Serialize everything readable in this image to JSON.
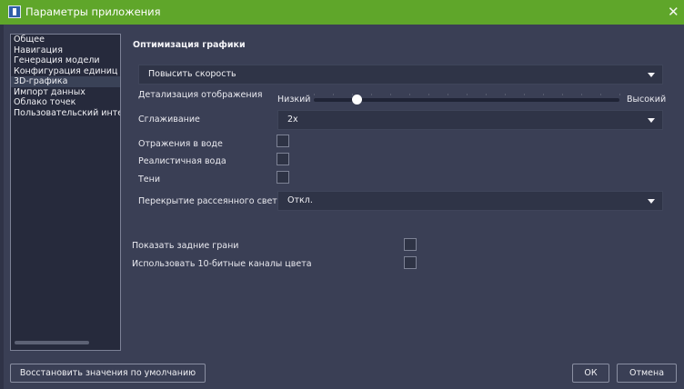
{
  "window": {
    "title": "Параметры приложения",
    "app_icon": "app-logo-icon",
    "close_glyph": "✕"
  },
  "sidebar": {
    "items": [
      {
        "label": "Общее",
        "active": false
      },
      {
        "label": "Навигация",
        "active": false
      },
      {
        "label": "Генерация модели",
        "active": false
      },
      {
        "label": "Конфигурация единиц из",
        "active": false
      },
      {
        "label": "3D-графика",
        "active": true
      },
      {
        "label": "Импорт данных",
        "active": false
      },
      {
        "label": "Облако точек",
        "active": false
      },
      {
        "label": "Пользовательский интер",
        "active": false
      }
    ]
  },
  "graphics": {
    "section_title": "Оптимизация графики",
    "optimization_mode": "Повысить скорость",
    "detail_label": "Детализация отображения",
    "detail_min_label": "Низкий",
    "detail_max_label": "Высокий",
    "detail_level": 0.14,
    "antialias_label": "Сглаживание",
    "antialias_value": "2x",
    "water_reflections_label": "Отражения в воде",
    "water_reflections_checked": false,
    "realistic_water_label": "Реалистичная вода",
    "realistic_water_checked": false,
    "shadows_label": "Тени",
    "shadows_checked": false,
    "ambient_occlusion_label": "Перекрытие рассеянного света",
    "ambient_occlusion_value": "Откл."
  },
  "display": {
    "backfaces_label": "Показать задние грани",
    "backfaces_checked": false,
    "color10bit_label": "Использовать 10-битные каналы цвета",
    "color10bit_checked": false
  },
  "footer": {
    "restore_label": "Восстановить значения по умолчанию",
    "ok_label": "ОК",
    "cancel_label": "Отмена"
  },
  "colors": {
    "titlebar": "#5fa62a",
    "background": "#3a3f55",
    "panel": "#262a3c",
    "input": "#2f3447"
  }
}
